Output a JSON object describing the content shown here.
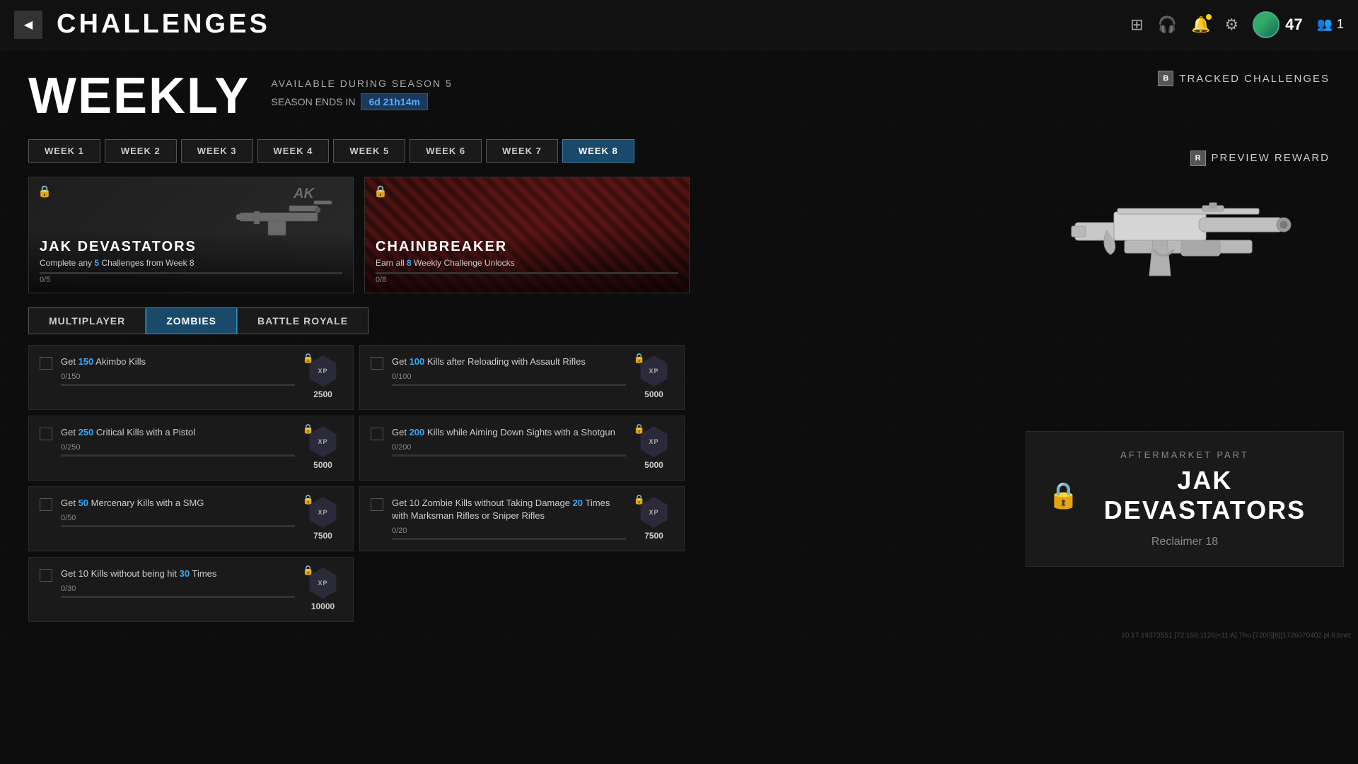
{
  "nav": {
    "title": "CHALLENGES",
    "back_icon": "◀",
    "level": "47",
    "squad": "1",
    "icons": {
      "grid": "⊞",
      "headset": "🎧",
      "bell": "🔔",
      "gear": "⚙"
    }
  },
  "weekly": {
    "title": "WEEKLY",
    "available": "AVAILABLE DURING SEASON 5",
    "season_ends_label": "SEASON ENDS IN",
    "timer": "6d 21h14m",
    "tracked_key": "B",
    "tracked_label": "TRACKED CHALLENGES",
    "preview_key": "R",
    "preview_label": "PREVIEW REWARD"
  },
  "week_tabs": [
    {
      "label": "WEEK 1",
      "active": false
    },
    {
      "label": "WEEK 2",
      "active": false
    },
    {
      "label": "WEEK 3",
      "active": false
    },
    {
      "label": "WEEK 4",
      "active": false
    },
    {
      "label": "WEEK 5",
      "active": false
    },
    {
      "label": "WEEK 6",
      "active": false
    },
    {
      "label": "WEEK 7",
      "active": false
    },
    {
      "label": "WEEK 8",
      "active": true
    }
  ],
  "reward_cards": [
    {
      "id": "jak",
      "name": "JAK DEVASTATORS",
      "description": "Complete any 5 Challenges from Week 8",
      "highlight_num": "5",
      "progress_current": 0,
      "progress_max": 5,
      "progress_label": "0/5",
      "type": "jak"
    },
    {
      "id": "chain",
      "name": "CHAINBREAKER",
      "description": "Earn all 8 Weekly Challenge Unlocks",
      "highlight_num": "8",
      "progress_current": 0,
      "progress_max": 8,
      "progress_label": "0/8",
      "type": "chain"
    }
  ],
  "mode_tabs": [
    {
      "label": "MULTIPLAYER",
      "active": false
    },
    {
      "label": "ZOMBIES",
      "active": true
    },
    {
      "label": "BATTLE ROYALE",
      "active": false
    }
  ],
  "challenges": [
    {
      "text_before": "Get ",
      "highlight": "150",
      "text_after": " Akimbo Kills",
      "progress_label": "0/150",
      "progress_pct": 0,
      "xp": "2500"
    },
    {
      "text_before": "Get ",
      "highlight": "100",
      "text_after": " Kills after Reloading with Assault Rifles",
      "progress_label": "0/100",
      "progress_pct": 0,
      "xp": "5000"
    },
    {
      "text_before": "Get ",
      "highlight": "250",
      "text_after": " Critical Kills with a Pistol",
      "progress_label": "0/250",
      "progress_pct": 0,
      "xp": "5000"
    },
    {
      "text_before": "Get ",
      "highlight": "200",
      "text_after": " Kills while Aiming Down Sights with a Shotgun",
      "progress_label": "0/200",
      "progress_pct": 0,
      "xp": "5000"
    },
    {
      "text_before": "Get ",
      "highlight": "50",
      "text_after": " Mercenary Kills with a SMG",
      "progress_label": "0/50",
      "progress_pct": 0,
      "xp": "7500"
    },
    {
      "text_before": "Get 10 Zombie Kills without Taking Damage ",
      "highlight": "20",
      "text_after": " Times with Marksman Rifles or Sniper Rifles",
      "progress_label": "0/20",
      "progress_pct": 0,
      "xp": "7500"
    },
    {
      "text_before": "Get 10 Kills without being hit ",
      "highlight": "30",
      "text_after": " Times",
      "progress_label": "0/30",
      "progress_pct": 0,
      "xp": "10000"
    }
  ],
  "right_panel": {
    "reward_type": "AFTERMARKET PART",
    "weapon_name": "JAK DEVASTATORS",
    "weapon_sub": "Reclaimer 18"
  },
  "status_bar": "10.17.19373551 [72:156:1126|+11:A] Thu [7200][8][1726070402.pl.6.bnet"
}
